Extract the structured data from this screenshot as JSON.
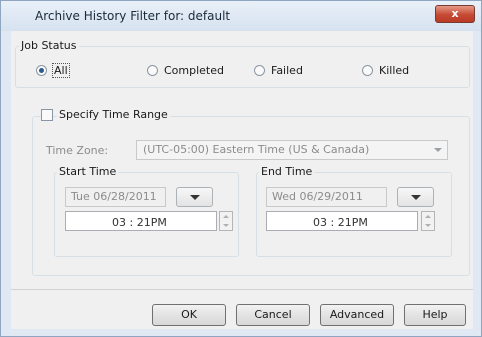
{
  "window": {
    "title": "Archive History Filter for: default",
    "close_symbol": "x"
  },
  "job_status": {
    "legend": "Job Status",
    "options": [
      "All",
      "Completed",
      "Failed",
      "Killed"
    ],
    "selected": "All"
  },
  "time_range": {
    "checkbox_label": "Specify Time Range",
    "checked": false,
    "timezone_label": "Time Zone:",
    "timezone_value": "(UTC-05:00) Eastern Time (US & Canada)",
    "start": {
      "legend": "Start Time",
      "date": "Tue 06/28/2011",
      "time": "03 : 21PM"
    },
    "end": {
      "legend": "End Time",
      "date": "Wed 06/29/2011",
      "time": "03 : 21PM"
    }
  },
  "buttons": {
    "ok": "OK",
    "cancel": "Cancel",
    "advanced": "Advanced",
    "help": "Help"
  },
  "icons": {
    "close": "close-icon",
    "dropdown": "chevron-down-icon",
    "spinner": "spinner-icon"
  },
  "colors": {
    "window_frame": "#dfe8f3",
    "client_bg": "#f0f0f0",
    "close_button": "#c64a34",
    "radio_dot": "#2c5a8a"
  }
}
